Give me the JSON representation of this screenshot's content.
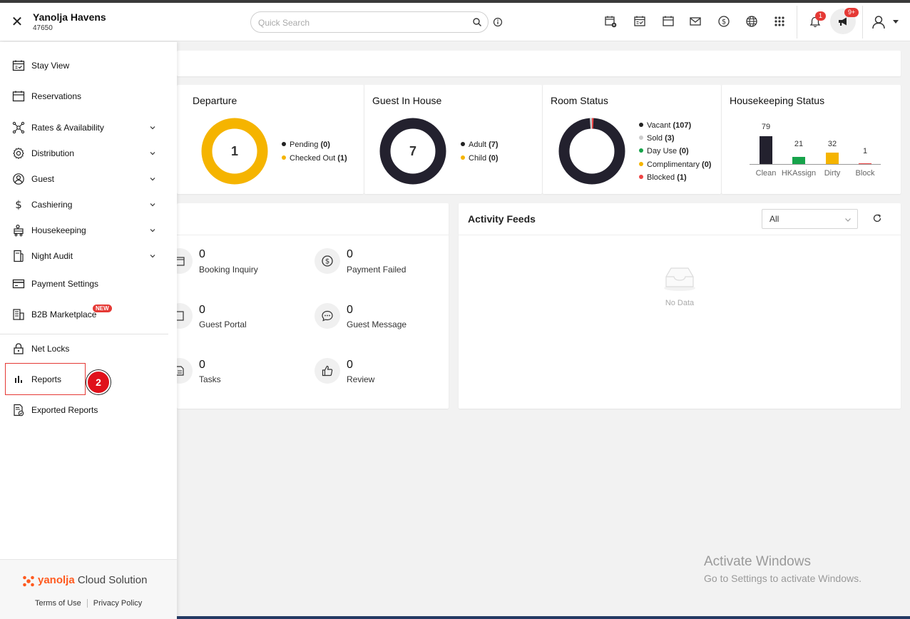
{
  "header": {
    "hotel_name": "Yanolja Havens",
    "hotel_id": "47650",
    "search_placeholder": "Quick Search",
    "notification_count": "1",
    "announcement_count": "9+"
  },
  "dashboard": {
    "departure": {
      "title": "Departure",
      "total": "1",
      "legend": [
        {
          "label": "Pending",
          "value": "(0)",
          "color": "#222222"
        },
        {
          "label": "Checked Out",
          "value": "(1)",
          "color": "#f5b400"
        }
      ]
    },
    "guest_in_house": {
      "title": "Guest In House",
      "total": "7",
      "legend": [
        {
          "label": "Adult",
          "value": "(7)",
          "color": "#222222"
        },
        {
          "label": "Child",
          "value": "(0)",
          "color": "#f5b400"
        }
      ]
    },
    "room_status": {
      "title": "Room Status",
      "legend": [
        {
          "label": "Vacant",
          "value": "(107)",
          "color": "#222222"
        },
        {
          "label": "Sold",
          "value": "(3)",
          "color": "#cccccc"
        },
        {
          "label": "Day Use",
          "value": "(0)",
          "color": "#16a34a"
        },
        {
          "label": "Complimentary",
          "value": "(0)",
          "color": "#f5b400"
        },
        {
          "label": "Blocked",
          "value": "(1)",
          "color": "#ef4444"
        }
      ]
    },
    "housekeeping_status": {
      "title": "Housekeeping Status",
      "bars": [
        {
          "label": "Clean",
          "value": "79",
          "color": "#23212e"
        },
        {
          "label": "HKAssign",
          "value": "21",
          "color": "#16a34a"
        },
        {
          "label": "Dirty",
          "value": "32",
          "color": "#f5b400"
        },
        {
          "label": "Block",
          "value": "1",
          "color": "#ef4444"
        }
      ]
    },
    "activities": [
      {
        "count": "0",
        "label": "Booking Inquiry"
      },
      {
        "count": "0",
        "label": "Payment Failed"
      },
      {
        "count": "0",
        "label": "Guest Portal"
      },
      {
        "count": "0",
        "label": "Guest Message"
      },
      {
        "count": "0",
        "label": "Tasks"
      },
      {
        "count": "0",
        "label": "Review"
      }
    ],
    "activity_feeds": {
      "title": "Activity Feeds",
      "filter_value": "All",
      "empty_text": "No Data"
    }
  },
  "sidebar": {
    "items": [
      {
        "label": "Stay View"
      },
      {
        "label": "Reservations"
      },
      {
        "label": "Rates & Availability"
      },
      {
        "label": "Distribution"
      },
      {
        "label": "Guest"
      },
      {
        "label": "Cashiering"
      },
      {
        "label": "Housekeeping"
      },
      {
        "label": "Night Audit"
      },
      {
        "label": "Payment Settings"
      },
      {
        "label": "B2B Marketplace"
      },
      {
        "label": "Net Locks"
      },
      {
        "label": "Reports"
      },
      {
        "label": "Exported Reports"
      }
    ],
    "new_badge": "NEW",
    "step_number": "2",
    "brand_prefix": "yanolja",
    "brand_suffix": " Cloud Solution",
    "terms_label": "Terms of Use",
    "privacy_label": "Privacy Policy"
  },
  "watermark": {
    "line1": "Activate Windows",
    "line2": "Go to Settings to activate Windows."
  }
}
